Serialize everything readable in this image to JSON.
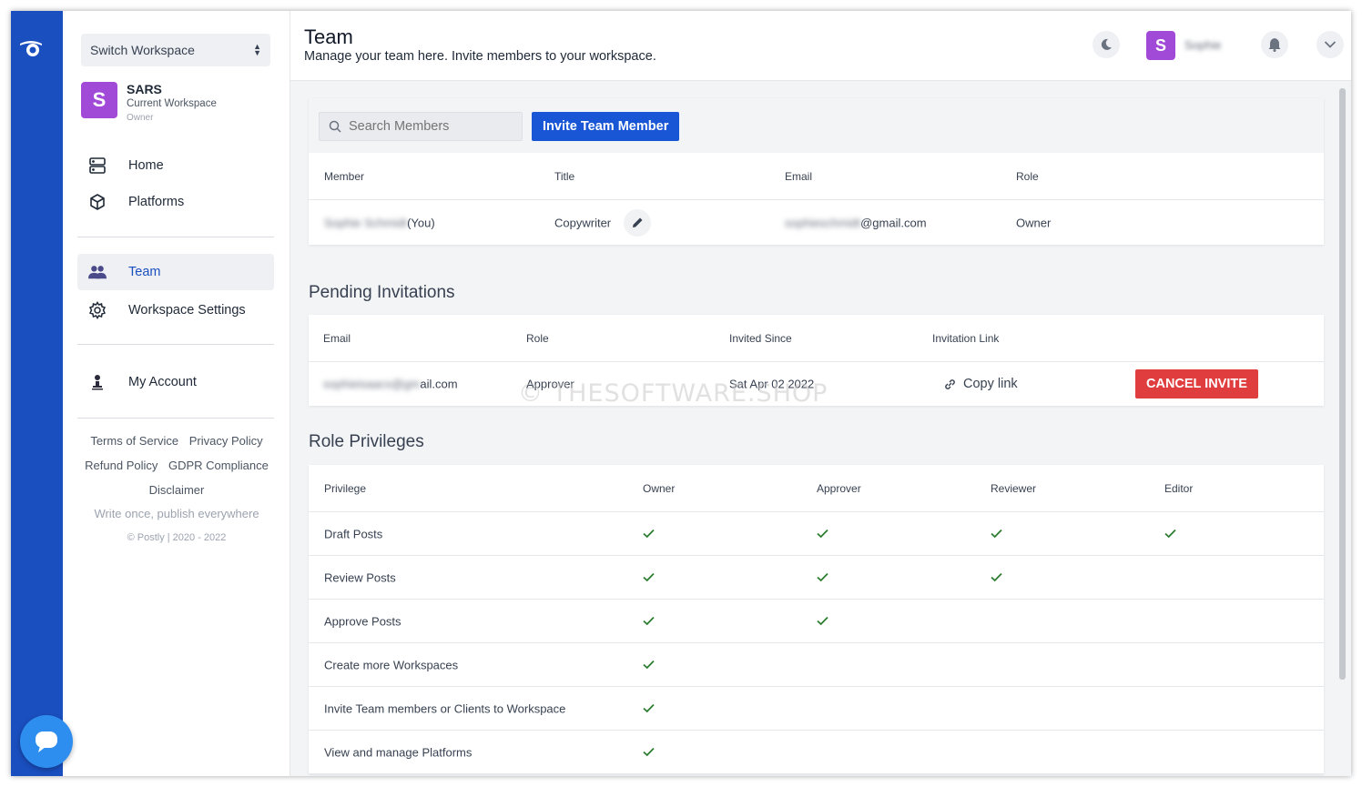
{
  "sidebar": {
    "workspace_switch_label": "Switch Workspace",
    "workspace": {
      "initial": "S",
      "name": "SARS",
      "subtitle": "Current Workspace",
      "role": "Owner",
      "avatar_color": "#a24ad8"
    },
    "nav_top": [
      {
        "label": "Home",
        "icon": "server-icon"
      },
      {
        "label": "Platforms",
        "icon": "cube-icon"
      }
    ],
    "nav_mid": [
      {
        "label": "Team",
        "icon": "users-icon",
        "active": true
      },
      {
        "label": "Workspace Settings",
        "icon": "gear-icon"
      }
    ],
    "nav_bottom": [
      {
        "label": "My Account",
        "icon": "person-icon"
      }
    ],
    "footer_links": [
      "Terms of Service",
      "Privacy Policy",
      "Refund Policy",
      "GDPR Compliance",
      "Disclaimer"
    ],
    "tagline": "Write once, publish everywhere",
    "copyright": "© Postly | 2020 - 2022"
  },
  "header": {
    "title": "Team",
    "subtitle": "Manage your team here. Invite members to your workspace.",
    "user_initial": "S",
    "user_name": "Sophie"
  },
  "members": {
    "search_placeholder": "Search Members",
    "invite_button": "Invite Team Member",
    "columns": [
      "Member",
      "Title",
      "Email",
      "Role"
    ],
    "rows": [
      {
        "member_hidden": "Sophie Schmidt",
        "member_suffix": "(You)",
        "title": "Copywriter",
        "email_hidden": "sophieschmidt",
        "email_suffix": "@gmail.com",
        "role": "Owner"
      }
    ]
  },
  "pending": {
    "title": "Pending Invitations",
    "columns": [
      "Email",
      "Role",
      "Invited Since",
      "Invitation Link"
    ],
    "rows": [
      {
        "email_hidden": "sophieisaacs@gm",
        "email_suffix": "ail.com",
        "role": "Approver",
        "invited_since": "Sat Apr 02 2022",
        "link_label": "Copy link",
        "cancel_label": "CANCEL INVITE"
      }
    ]
  },
  "privileges": {
    "title": "Role Privileges",
    "columns": [
      "Privilege",
      "Owner",
      "Approver",
      "Reviewer",
      "Editor"
    ],
    "rows": [
      {
        "name": "Draft Posts",
        "grants": [
          true,
          true,
          true,
          true
        ]
      },
      {
        "name": "Review Posts",
        "grants": [
          true,
          true,
          true,
          false
        ]
      },
      {
        "name": "Approve Posts",
        "grants": [
          true,
          true,
          false,
          false
        ]
      },
      {
        "name": "Create more Workspaces",
        "grants": [
          true,
          false,
          false,
          false
        ]
      },
      {
        "name": "Invite Team members or Clients to Workspace",
        "grants": [
          true,
          false,
          false,
          false
        ]
      },
      {
        "name": "View and manage Platforms",
        "grants": [
          true,
          false,
          false,
          false
        ]
      }
    ]
  },
  "watermark": "© THESOFTWARE.SHOP",
  "colors": {
    "rail": "#1a4fbf",
    "primary": "#1856d6",
    "danger": "#e03e3e",
    "check": "#2e7d32"
  }
}
